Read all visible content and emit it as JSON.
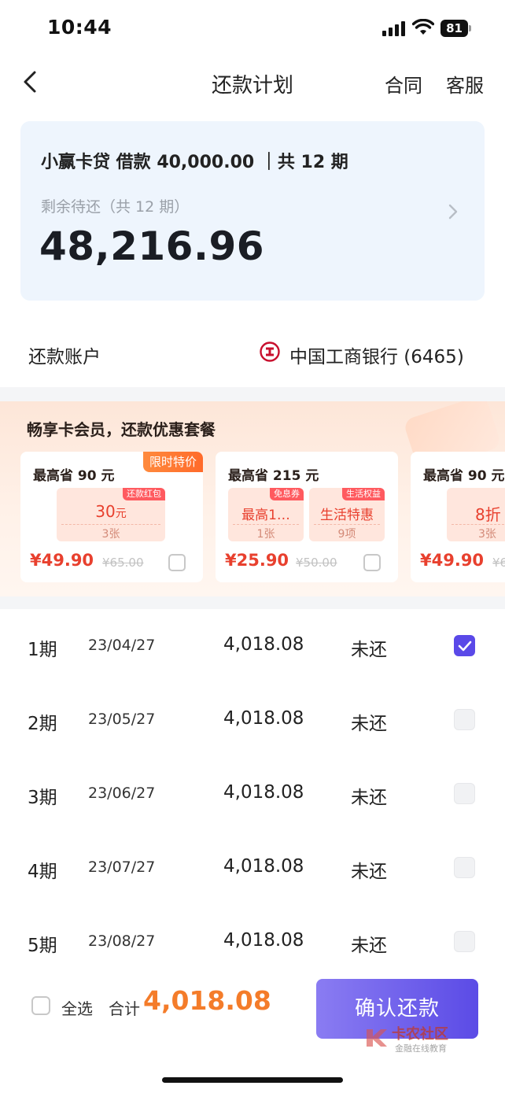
{
  "status_bar": {
    "time": "10:44",
    "battery": "81"
  },
  "nav": {
    "title": "还款计划",
    "contract": "合同",
    "service": "客服"
  },
  "summary": {
    "heading": "小赢卡贷 借款 40,000.00 ｜共 12 期",
    "remain_label": "剩余待还（共 12 期）",
    "remain_amount": "48,216.96"
  },
  "account": {
    "label": "还款账户",
    "bank": "中国工商银行 (6465)"
  },
  "promo": {
    "title": "畅享卡会员，还款优惠套餐",
    "packages": [
      {
        "title": "最高省 90 元",
        "badge": "限时特价",
        "coupons": [
          {
            "tag": "还款红包",
            "value": "30",
            "unit": "元",
            "sub": "3张"
          }
        ],
        "price": "¥49.90",
        "original": "¥65.00",
        "checked": false
      },
      {
        "title": "最高省 215 元",
        "badge": "",
        "coupons": [
          {
            "tag": "免息券",
            "value": "最高1…",
            "unit": "",
            "sub": "1张"
          },
          {
            "tag": "生活权益",
            "value": "生活特惠",
            "unit": "",
            "sub": "9项"
          }
        ],
        "price": "¥25.90",
        "original": "¥50.00",
        "checked": false
      },
      {
        "title": "最高省 90 元",
        "badge": "",
        "coupons": [
          {
            "tag": "",
            "value": "8折",
            "unit": "",
            "sub": "3张"
          }
        ],
        "price": "¥49.90",
        "original": "¥6…",
        "checked": false
      }
    ]
  },
  "installments": [
    {
      "period": "1期",
      "date": "23/04/27",
      "amount": "4,018.08",
      "status": "未还",
      "checked": true
    },
    {
      "period": "2期",
      "date": "23/05/27",
      "amount": "4,018.08",
      "status": "未还",
      "checked": false
    },
    {
      "period": "3期",
      "date": "23/06/27",
      "amount": "4,018.08",
      "status": "未还",
      "checked": false
    },
    {
      "period": "4期",
      "date": "23/07/27",
      "amount": "4,018.08",
      "status": "未还",
      "checked": false
    },
    {
      "period": "5期",
      "date": "23/08/27",
      "amount": "4,018.08",
      "status": "未还",
      "checked": false
    }
  ],
  "bottom": {
    "select_all": "全选",
    "total_label": "合计",
    "total_amount": "4,018.08",
    "confirm": "确认还款"
  },
  "watermark": {
    "text": "卡农社区",
    "sub": "金融在线教育"
  },
  "colors": {
    "accent": "#5a49e8",
    "price": "#e8402e",
    "total": "#f47c2a",
    "card_bg": "#eef5fd"
  }
}
